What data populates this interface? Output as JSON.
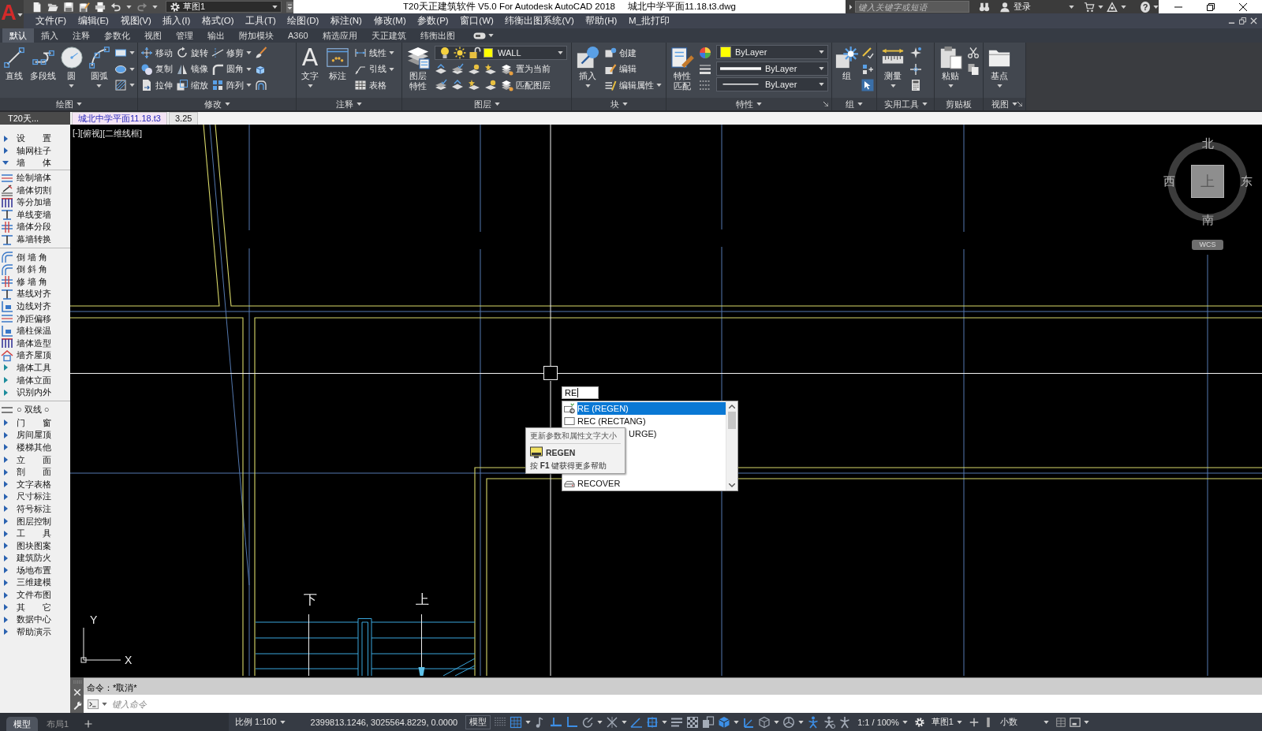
{
  "title_bar": {
    "logo": "A",
    "workspace": "草图1",
    "title": "T20天正建筑软件 V5.0 For Autodesk AutoCAD 2018",
    "document": "城北中学平面11.18.t3.dwg",
    "search": {
      "placeholder": "键入关键字或短语"
    },
    "sign_in": "登录",
    "help": "?"
  },
  "menu_bar": [
    "文件(F)",
    "编辑(E)",
    "视图(V)",
    "插入(I)",
    "格式(O)",
    "工具(T)",
    "绘图(D)",
    "标注(N)",
    "修改(M)",
    "参数(P)",
    "窗口(W)",
    "纬衡出图系统(V)",
    "帮助(H)",
    "M_批打印"
  ],
  "ribbon_tabs": [
    {
      "label": "默认",
      "selected": true
    },
    {
      "label": "插入",
      "selected": false
    },
    {
      "label": "注释",
      "selected": false
    },
    {
      "label": "参数化",
      "selected": false
    },
    {
      "label": "视图",
      "selected": false
    },
    {
      "label": "管理",
      "selected": false
    },
    {
      "label": "输出",
      "selected": false
    },
    {
      "label": "附加模块",
      "selected": false
    },
    {
      "label": "A360",
      "selected": false
    },
    {
      "label": "精选应用",
      "selected": false
    },
    {
      "label": "天正建筑",
      "selected": false
    },
    {
      "label": "纬衡出图",
      "selected": false
    }
  ],
  "ribbon_panels": [
    {
      "kind": "standard",
      "title": "绘图",
      "menu": true,
      "launcher": false,
      "large": [
        {
          "label": "直线",
          "menu": false
        },
        {
          "label": "多段线",
          "menu": false
        },
        {
          "label": "圆",
          "menu": true
        },
        {
          "label": "圆弧",
          "menu": true
        }
      ],
      "columns": [
        [
          {
            "menu": true
          },
          {
            "menu": true
          },
          {
            "menu": true
          }
        ]
      ]
    },
    {
      "kind": "standard",
      "title": "修改",
      "menu": true,
      "launcher": false,
      "columns": [
        [
          {
            "label": "移动",
            "menu": false
          },
          {
            "label": "复制",
            "menu": false
          },
          {
            "label": "拉伸",
            "menu": false
          }
        ],
        [
          {
            "label": "旋转",
            "menu": false
          },
          {
            "label": "镜像",
            "menu": false
          },
          {
            "label": "缩放",
            "menu": false
          }
        ],
        [
          {
            "label": "修剪",
            "menu": true
          },
          {
            "label": "圆角",
            "menu": true
          },
          {
            "label": "阵列",
            "menu": true
          }
        ],
        [
          {
            "menu": false
          },
          {
            "menu": false
          },
          {
            "menu": false
          }
        ]
      ]
    },
    {
      "kind": "standard",
      "title": "注释",
      "menu": true,
      "launcher": false,
      "large": [
        {
          "label": "文字",
          "glyph": "A",
          "menu": true
        },
        {
          "label": "标注",
          "menu": false
        }
      ],
      "columns": [
        [
          {
            "label": "线性",
            "menu": true
          },
          {
            "label": "引线",
            "menu": true
          },
          {
            "label": "表格",
            "menu": false
          }
        ]
      ]
    },
    {
      "kind": "layers",
      "title": "图层",
      "menu": true,
      "launcher": false,
      "large": [
        {
          "label": "图层特性",
          "menu": false
        }
      ],
      "layer": {
        "name": "WALL",
        "on": true,
        "frozen": false,
        "locked": false
      },
      "rows": [
        [
          {
            "menu": false
          },
          {
            "menu": false
          },
          {
            "menu": false
          },
          {
            "menu": false
          },
          {
            "label": "置为当前",
            "menu": false
          }
        ],
        [
          {
            "menu": false
          },
          {
            "menu": false
          },
          {
            "menu": false
          },
          {
            "menu": false
          },
          {
            "label": "匹配图层",
            "menu": false
          }
        ]
      ]
    },
    {
      "kind": "standard",
      "title": "块",
      "menu": true,
      "launcher": false,
      "large": [
        {
          "label": "插入",
          "menu": true
        }
      ],
      "columns": [
        [
          {
            "label": "创建",
            "menu": false
          },
          {
            "label": "编辑",
            "menu": false
          },
          {
            "label": "编辑属性",
            "menu": true
          }
        ]
      ]
    },
    {
      "kind": "properties",
      "title": "特性",
      "menu": true,
      "launcher": true,
      "large": [
        {
          "label": "特性匹配",
          "menu": false
        }
      ],
      "combos": [
        {
          "kind": "color",
          "value": "ByLayer"
        },
        {
          "kind": "lineweight",
          "value": "ByLayer"
        },
        {
          "kind": "linetype",
          "value": "ByLayer"
        }
      ]
    },
    {
      "kind": "standard",
      "title": "组",
      "menu": true,
      "launcher": false,
      "large": [
        {
          "label": "组",
          "menu": false
        }
      ],
      "columns": [
        [
          {
            "menu": false
          },
          {
            "menu": false
          },
          {
            "menu": false
          }
        ]
      ]
    },
    {
      "kind": "standard",
      "title": "实用工具",
      "menu": true,
      "launcher": false,
      "large": [
        {
          "label": "测量",
          "menu": true
        }
      ],
      "columns": [
        [
          {
            "menu": false
          },
          {
            "menu": false
          },
          {
            "menu": false
          }
        ]
      ]
    },
    {
      "kind": "standard",
      "title": "剪贴板",
      "menu": false,
      "launcher": false,
      "large": [
        {
          "label": "粘贴",
          "menu": true
        }
      ],
      "columns": [
        [
          {
            "menu": false
          },
          {
            "menu": false
          }
        ]
      ]
    },
    {
      "kind": "standard",
      "title": "视图",
      "menu": true,
      "launcher": true,
      "large": [
        {
          "label": "基点",
          "menu": true
        }
      ]
    }
  ],
  "document_tabs": [
    {
      "label": "城北中学平面11.18.t3",
      "selected": true
    },
    {
      "label": "3.25",
      "selected": false
    }
  ],
  "sidebar": {
    "title": "T20天...",
    "items": [
      {
        "kind": "group",
        "label": "设　　置",
        "expanded": false
      },
      {
        "kind": "group",
        "label": "轴网柱子",
        "expanded": false
      },
      {
        "kind": "group",
        "label": "墙　　体",
        "expanded": true,
        "children": [
          {
            "kind": "command",
            "label": "绘制墙体"
          },
          {
            "kind": "command",
            "label": "墙体切割"
          },
          {
            "kind": "command",
            "label": "等分加墙"
          },
          {
            "kind": "command",
            "label": "单线变墙"
          },
          {
            "kind": "command",
            "label": "墙体分段"
          },
          {
            "kind": "command",
            "label": "幕墙转换"
          },
          {
            "kind": "separator"
          },
          {
            "kind": "command",
            "label": "倒 墙 角"
          },
          {
            "kind": "command",
            "label": "倒 斜 角"
          },
          {
            "kind": "command",
            "label": "修 墙 角"
          },
          {
            "kind": "command",
            "label": "基线对齐"
          },
          {
            "kind": "command",
            "label": "边线对齐"
          },
          {
            "kind": "command",
            "label": "净距偏移"
          },
          {
            "kind": "command",
            "label": "墙柱保温"
          },
          {
            "kind": "command",
            "label": "墙体造型"
          },
          {
            "kind": "command",
            "label": "墙齐屋顶"
          },
          {
            "kind": "group",
            "label": "墙体工具",
            "expanded": false
          },
          {
            "kind": "group",
            "label": "墙体立面",
            "expanded": false
          },
          {
            "kind": "group",
            "label": "识别内外",
            "expanded": false
          }
        ]
      },
      {
        "kind": "toggle",
        "label": "○ 双线 ○"
      },
      {
        "kind": "group",
        "label": "门　　窗",
        "expanded": false
      },
      {
        "kind": "group",
        "label": "房间屋顶",
        "expanded": false
      },
      {
        "kind": "group",
        "label": "楼梯其他",
        "expanded": false
      },
      {
        "kind": "group",
        "label": "立　　面",
        "expanded": false
      },
      {
        "kind": "group",
        "label": "剖　　面",
        "expanded": false
      },
      {
        "kind": "group",
        "label": "文字表格",
        "expanded": false
      },
      {
        "kind": "group",
        "label": "尺寸标注",
        "expanded": false
      },
      {
        "kind": "group",
        "label": "符号标注",
        "expanded": false
      },
      {
        "kind": "group",
        "label": "图层控制",
        "expanded": false
      },
      {
        "kind": "group",
        "label": "工　　具",
        "expanded": false
      },
      {
        "kind": "group",
        "label": "图块图案",
        "expanded": false
      },
      {
        "kind": "group",
        "label": "建筑防火",
        "expanded": false
      },
      {
        "kind": "group",
        "label": "场地布置",
        "expanded": false
      },
      {
        "kind": "group",
        "label": "三维建模",
        "expanded": false
      },
      {
        "kind": "group",
        "label": "文件布图",
        "expanded": false
      },
      {
        "kind": "group",
        "label": "其　　它",
        "expanded": false
      },
      {
        "kind": "group",
        "label": "数据中心",
        "expanded": false
      },
      {
        "kind": "group",
        "label": "帮助演示",
        "expanded": false
      }
    ]
  },
  "drawing": {
    "viewport_controls": [
      "[-]",
      "[俯视]",
      "[二维线框]"
    ],
    "stair_labels": [
      "下",
      "上"
    ],
    "ucs": {
      "x": "X",
      "y": "Y"
    },
    "viewcube": {
      "north": "北",
      "west": "西",
      "east": "东",
      "south": "南",
      "face": "上",
      "wcs": "WCS"
    },
    "dynamic_input": "RE",
    "autocomplete": [
      {
        "kind": "full",
        "label": "RE (REGEN)",
        "selected": true
      },
      {
        "kind": "full",
        "label": "REC (RECTANG)",
        "selected": false
      },
      {
        "kind": "covered",
        "label": "URGE)",
        "selected": false
      },
      {
        "kind": "full",
        "label": "RECOVER",
        "selected": false
      }
    ],
    "tooltip": {
      "description": "更新参数和属性文字大小",
      "command": "REGEN",
      "help": "按 **F1** 键获得更多帮助"
    }
  },
  "command_line": {
    "history": "命令：*取消*",
    "placeholder": "键入命令"
  },
  "status_bar": {
    "layout_tabs": [
      {
        "label": "模型",
        "selected": true
      },
      {
        "label": "布局1",
        "selected": false
      }
    ],
    "scale": "比例 1:100",
    "coordinates": "2399813.1246, 3025564.8229, 0.0000",
    "space": "模型",
    "toggles": [
      {
        "on": false,
        "menu": false
      },
      {
        "on": true,
        "menu": true
      },
      {
        "on": false,
        "menu": false
      },
      {
        "on": true,
        "menu": false
      },
      {
        "on": true,
        "menu": false
      },
      {
        "on": false,
        "menu": true
      },
      {
        "on": false,
        "menu": true
      },
      {
        "on": true,
        "menu": false
      },
      {
        "on": true,
        "menu": true
      },
      {
        "on": false,
        "menu": false
      },
      {
        "on": false,
        "menu": false
      },
      {
        "on": false,
        "menu": false
      },
      {
        "on": true,
        "menu": true
      },
      {
        "on": true,
        "menu": false
      },
      {
        "on": false,
        "menu": true
      },
      {
        "on": false,
        "menu": true
      },
      {
        "on": true,
        "menu": false
      },
      {
        "on": false,
        "menu": false
      },
      {
        "on": false,
        "menu": false
      }
    ],
    "annotation_scale": "1:1 / 100%",
    "workspace": "草图1",
    "units": "小数"
  }
}
